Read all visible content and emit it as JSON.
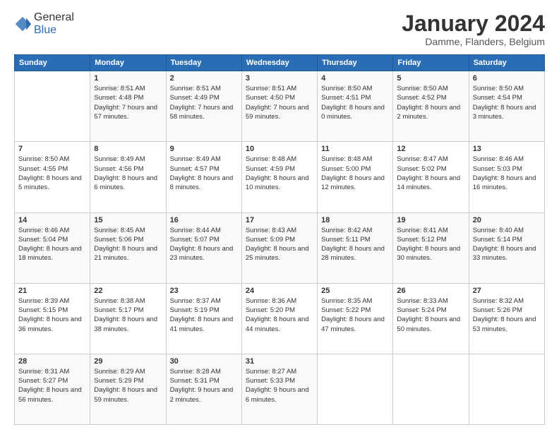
{
  "header": {
    "logo_general": "General",
    "logo_blue": "Blue",
    "month_title": "January 2024",
    "location": "Damme, Flanders, Belgium"
  },
  "weekdays": [
    "Sunday",
    "Monday",
    "Tuesday",
    "Wednesday",
    "Thursday",
    "Friday",
    "Saturday"
  ],
  "weeks": [
    [
      {
        "day": "",
        "sunrise": "",
        "sunset": "",
        "daylight": ""
      },
      {
        "day": "1",
        "sunrise": "8:51 AM",
        "sunset": "4:48 PM",
        "daylight": "7 hours and 57 minutes."
      },
      {
        "day": "2",
        "sunrise": "8:51 AM",
        "sunset": "4:49 PM",
        "daylight": "7 hours and 58 minutes."
      },
      {
        "day": "3",
        "sunrise": "8:51 AM",
        "sunset": "4:50 PM",
        "daylight": "7 hours and 59 minutes."
      },
      {
        "day": "4",
        "sunrise": "8:50 AM",
        "sunset": "4:51 PM",
        "daylight": "8 hours and 0 minutes."
      },
      {
        "day": "5",
        "sunrise": "8:50 AM",
        "sunset": "4:52 PM",
        "daylight": "8 hours and 2 minutes."
      },
      {
        "day": "6",
        "sunrise": "8:50 AM",
        "sunset": "4:54 PM",
        "daylight": "8 hours and 3 minutes."
      }
    ],
    [
      {
        "day": "7",
        "sunrise": "8:50 AM",
        "sunset": "4:55 PM",
        "daylight": "8 hours and 5 minutes."
      },
      {
        "day": "8",
        "sunrise": "8:49 AM",
        "sunset": "4:56 PM",
        "daylight": "8 hours and 6 minutes."
      },
      {
        "day": "9",
        "sunrise": "8:49 AM",
        "sunset": "4:57 PM",
        "daylight": "8 hours and 8 minutes."
      },
      {
        "day": "10",
        "sunrise": "8:48 AM",
        "sunset": "4:59 PM",
        "daylight": "8 hours and 10 minutes."
      },
      {
        "day": "11",
        "sunrise": "8:48 AM",
        "sunset": "5:00 PM",
        "daylight": "8 hours and 12 minutes."
      },
      {
        "day": "12",
        "sunrise": "8:47 AM",
        "sunset": "5:02 PM",
        "daylight": "8 hours and 14 minutes."
      },
      {
        "day": "13",
        "sunrise": "8:46 AM",
        "sunset": "5:03 PM",
        "daylight": "8 hours and 16 minutes."
      }
    ],
    [
      {
        "day": "14",
        "sunrise": "8:46 AM",
        "sunset": "5:04 PM",
        "daylight": "8 hours and 18 minutes."
      },
      {
        "day": "15",
        "sunrise": "8:45 AM",
        "sunset": "5:06 PM",
        "daylight": "8 hours and 21 minutes."
      },
      {
        "day": "16",
        "sunrise": "8:44 AM",
        "sunset": "5:07 PM",
        "daylight": "8 hours and 23 minutes."
      },
      {
        "day": "17",
        "sunrise": "8:43 AM",
        "sunset": "5:09 PM",
        "daylight": "8 hours and 25 minutes."
      },
      {
        "day": "18",
        "sunrise": "8:42 AM",
        "sunset": "5:11 PM",
        "daylight": "8 hours and 28 minutes."
      },
      {
        "day": "19",
        "sunrise": "8:41 AM",
        "sunset": "5:12 PM",
        "daylight": "8 hours and 30 minutes."
      },
      {
        "day": "20",
        "sunrise": "8:40 AM",
        "sunset": "5:14 PM",
        "daylight": "8 hours and 33 minutes."
      }
    ],
    [
      {
        "day": "21",
        "sunrise": "8:39 AM",
        "sunset": "5:15 PM",
        "daylight": "8 hours and 36 minutes."
      },
      {
        "day": "22",
        "sunrise": "8:38 AM",
        "sunset": "5:17 PM",
        "daylight": "8 hours and 38 minutes."
      },
      {
        "day": "23",
        "sunrise": "8:37 AM",
        "sunset": "5:19 PM",
        "daylight": "8 hours and 41 minutes."
      },
      {
        "day": "24",
        "sunrise": "8:36 AM",
        "sunset": "5:20 PM",
        "daylight": "8 hours and 44 minutes."
      },
      {
        "day": "25",
        "sunrise": "8:35 AM",
        "sunset": "5:22 PM",
        "daylight": "8 hours and 47 minutes."
      },
      {
        "day": "26",
        "sunrise": "8:33 AM",
        "sunset": "5:24 PM",
        "daylight": "8 hours and 50 minutes."
      },
      {
        "day": "27",
        "sunrise": "8:32 AM",
        "sunset": "5:26 PM",
        "daylight": "8 hours and 53 minutes."
      }
    ],
    [
      {
        "day": "28",
        "sunrise": "8:31 AM",
        "sunset": "5:27 PM",
        "daylight": "8 hours and 56 minutes."
      },
      {
        "day": "29",
        "sunrise": "8:29 AM",
        "sunset": "5:29 PM",
        "daylight": "8 hours and 59 minutes."
      },
      {
        "day": "30",
        "sunrise": "8:28 AM",
        "sunset": "5:31 PM",
        "daylight": "9 hours and 2 minutes."
      },
      {
        "day": "31",
        "sunrise": "8:27 AM",
        "sunset": "5:33 PM",
        "daylight": "9 hours and 6 minutes."
      },
      {
        "day": "",
        "sunrise": "",
        "sunset": "",
        "daylight": ""
      },
      {
        "day": "",
        "sunrise": "",
        "sunset": "",
        "daylight": ""
      },
      {
        "day": "",
        "sunrise": "",
        "sunset": "",
        "daylight": ""
      }
    ]
  ],
  "labels": {
    "sunrise_prefix": "Sunrise: ",
    "sunset_prefix": "Sunset: ",
    "daylight_prefix": "Daylight: "
  }
}
